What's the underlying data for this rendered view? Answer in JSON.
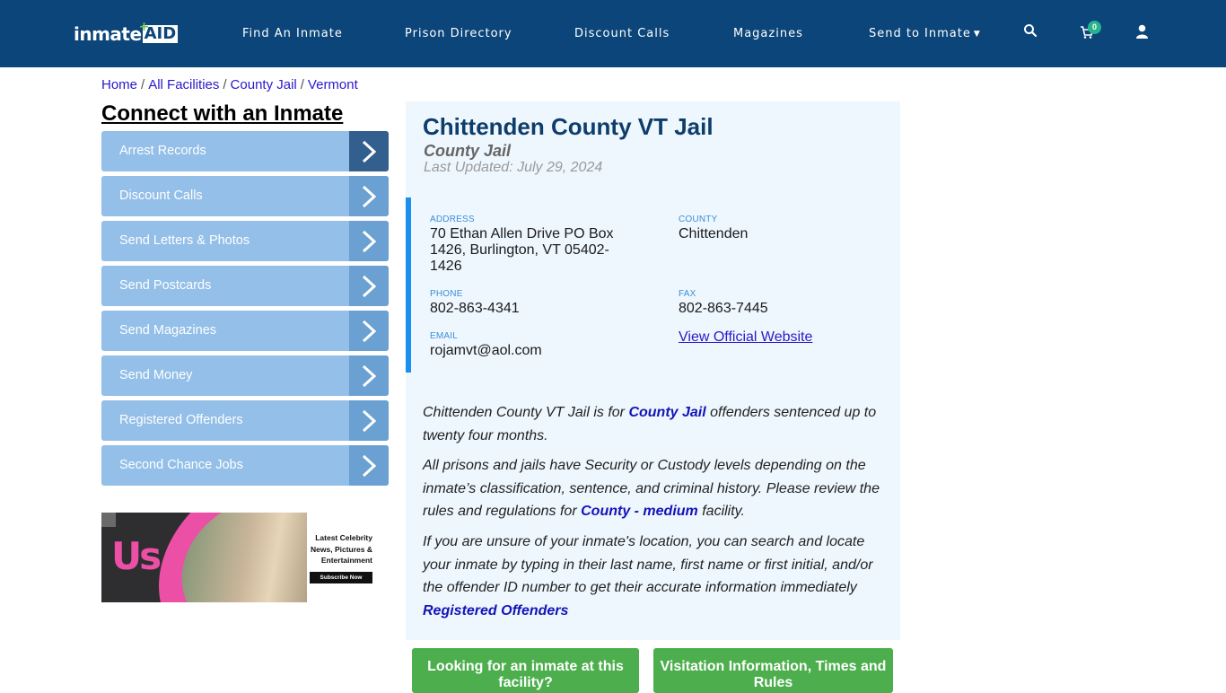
{
  "header": {
    "logo": {
      "part1": "inmate",
      "part2": "AID",
      "plus": "+"
    },
    "nav": [
      {
        "label": "Find An Inmate"
      },
      {
        "label": "Prison Directory"
      },
      {
        "label": "Discount Calls"
      },
      {
        "label": "Magazines"
      },
      {
        "label": "Send to Inmate",
        "has_dropdown": true
      }
    ],
    "cart_count": "0",
    "icons": [
      "search-icon",
      "cart-icon",
      "user-icon"
    ]
  },
  "breadcrumb": [
    {
      "label": "Home"
    },
    {
      "label": "All Facilities"
    },
    {
      "label": "County Jail"
    },
    {
      "label": "Vermont"
    }
  ],
  "breadcrumb_separator": "/",
  "sidebar": {
    "title": "Connect with an Inmate",
    "items": [
      {
        "label": "Arrest Records"
      },
      {
        "label": "Discount Calls"
      },
      {
        "label": "Send Letters & Photos"
      },
      {
        "label": "Send Postcards"
      },
      {
        "label": "Send Magazines"
      },
      {
        "label": "Send Money"
      },
      {
        "label": "Registered Offenders"
      },
      {
        "label": "Second Chance Jobs"
      }
    ],
    "ad": {
      "brand": "Us",
      "tagline_lines": [
        "Latest Celebrity",
        "News, Pictures &",
        "Entertainment"
      ],
      "button": "Subscribe Now"
    }
  },
  "facility": {
    "name": "Chittenden County VT Jail",
    "type": "County Jail",
    "last_updated": "Last Updated: July 29, 2024",
    "info": {
      "address_label": "ADDRESS",
      "address_lines": [
        "70 Ethan Allen Drive PO Box",
        "1426, Burlington, VT 05402-",
        "1426"
      ],
      "county_label": "COUNTY",
      "county": "Chittenden",
      "phone_label": "PHONE",
      "phone": "802-863-4341",
      "fax_label": "FAX",
      "fax": "802-863-7445",
      "email_label": "EMAIL",
      "email": "rojamvt@aol.com",
      "website_link": "View Official Website"
    },
    "description": {
      "p1_a": "Chittenden County VT Jail is for ",
      "p1_link": "County Jail",
      "p1_b": " offenders sentenced up to twenty four months.",
      "p2_a": "All prisons and jails have Security or Custody levels depending on the inmate’s classification, sentence, and criminal history. Please review the rules and regulations for ",
      "p2_link": "County - medium",
      "p2_b": " facility.",
      "p3": "If you are unsure of your inmate's location, you can search and locate your inmate by typing in their last name, first name or first initial, and/or the offender ID number to get their accurate information immediately",
      "p3_link": "Registered Offenders"
    },
    "buttons": [
      {
        "label": "Looking for an inmate at this facility?"
      },
      {
        "label": "Visitation Information, Times and Rules"
      }
    ]
  },
  "colors": {
    "navbar": "#0b4579",
    "sidebar_item": "#93bfe8",
    "sidebar_arrow": "#6aa0d2",
    "panel_bg": "#eef7fe",
    "accent_border": "#1a8ff0",
    "green_button": "#4cae4c",
    "link": "#2a19c9"
  }
}
